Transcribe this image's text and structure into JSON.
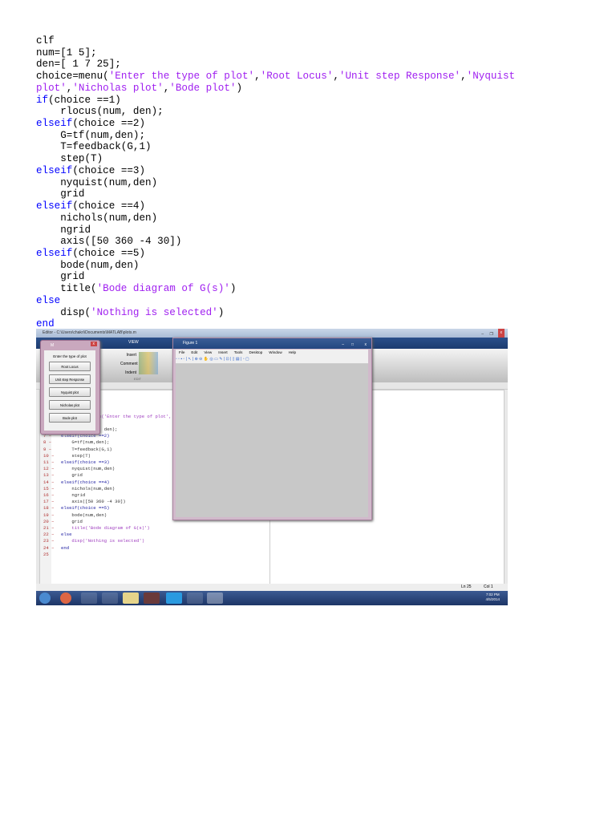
{
  "code": [
    [
      [
        "p",
        "clf"
      ]
    ],
    [
      [
        "p",
        "num=[1 5];"
      ]
    ],
    [
      [
        "p",
        "den=[ 1 7 25];"
      ]
    ],
    [
      [
        "p",
        "choice=menu("
      ],
      [
        "s",
        "'Enter the type of plot'"
      ],
      [
        "p",
        ","
      ],
      [
        "s",
        "'Root Locus'"
      ],
      [
        "p",
        ","
      ],
      [
        "s",
        "'Unit step Response'"
      ],
      [
        "p",
        ","
      ],
      [
        "s",
        "'Nyquist"
      ]
    ],
    [
      [
        "s",
        "plot'"
      ],
      [
        "p",
        ","
      ],
      [
        "s",
        "'Nicholas plot'"
      ],
      [
        "p",
        ","
      ],
      [
        "s",
        "'Bode plot'"
      ],
      [
        "p",
        ")"
      ]
    ],
    [
      [
        "k",
        "if"
      ],
      [
        "p",
        "(choice ==1)"
      ]
    ],
    [
      [
        "p",
        "    rlocus(num, den);"
      ]
    ],
    [
      [
        "k",
        "elseif"
      ],
      [
        "p",
        "(choice ==2)"
      ]
    ],
    [
      [
        "p",
        "    G=tf(num,den);"
      ]
    ],
    [
      [
        "p",
        "    T=feedback(G,1)"
      ]
    ],
    [
      [
        "p",
        "    step(T)"
      ]
    ],
    [
      [
        "k",
        "elseif"
      ],
      [
        "p",
        "(choice ==3)"
      ]
    ],
    [
      [
        "p",
        "    nyquist(num,den)"
      ]
    ],
    [
      [
        "p",
        "    grid"
      ]
    ],
    [
      [
        "k",
        "elseif"
      ],
      [
        "p",
        "(choice ==4)"
      ]
    ],
    [
      [
        "p",
        "    nichols(num,den)"
      ]
    ],
    [
      [
        "p",
        "    ngrid"
      ]
    ],
    [
      [
        "p",
        "    axis([50 360 -4 30])"
      ]
    ],
    [
      [
        "k",
        "elseif"
      ],
      [
        "p",
        "(choice ==5)"
      ]
    ],
    [
      [
        "p",
        "    bode(num,den)"
      ]
    ],
    [
      [
        "p",
        "    grid"
      ]
    ],
    [
      [
        "p",
        "    title("
      ],
      [
        "s",
        "'Bode diagram of G(s)'"
      ],
      [
        "p",
        ")"
      ]
    ],
    [
      [
        "k",
        "else"
      ]
    ],
    [
      [
        "p",
        "    disp("
      ],
      [
        "s",
        "'Nothing is selected'"
      ],
      [
        "p",
        ")"
      ]
    ],
    [
      [
        "k",
        "end"
      ]
    ]
  ],
  "screenshot": {
    "editor_title": "Editor - C:\\Users\\chakri\\Documents\\MATLAB\\plots.m",
    "ribbon_tab": "VIEW",
    "ribbon_edit": {
      "insert": "Insert",
      "comment": "Comment",
      "indent": "Indent",
      "group": "EDIT"
    },
    "editor_lines": [
      "",
      "",
      "",
      "    choice=menu('Enter the type of plot','Root",
      "",
      "    rlocus(num, den);",
      "elseif(choice ==2)",
      "    G=tf(num,den);",
      "    T=feedback(G,1)",
      "    step(T)",
      "elseif(choice ==3)",
      "    nyquist(num,den)",
      "    grid",
      "elseif(choice ==4)",
      "    nichols(num,den)",
      "    ngrid",
      "    axis([50 360 -4 30])",
      "elseif(choice ==5)",
      "    bode(num,den)",
      "    grid",
      "    title('Bode diagram of G(s)')",
      "else",
      "    disp('Nothing is selected')",
      "end",
      ""
    ],
    "status": {
      "ln": "Ln  25",
      "col": "Col  1"
    },
    "clock": {
      "time": "7:02 PM",
      "date": "4/5/2014"
    },
    "menu_dialog": {
      "title": "M",
      "prompt": "Enter the type of plot",
      "buttons": [
        "Root Locus",
        "Unit step Response",
        "Nyquist plot",
        "Nicholas plot",
        "Bode plot"
      ]
    },
    "figure": {
      "title": "Figure 1",
      "menus": [
        "File",
        "Edit",
        "View",
        "Insert",
        "Tools",
        "Desktop",
        "Window",
        "Help"
      ]
    }
  }
}
